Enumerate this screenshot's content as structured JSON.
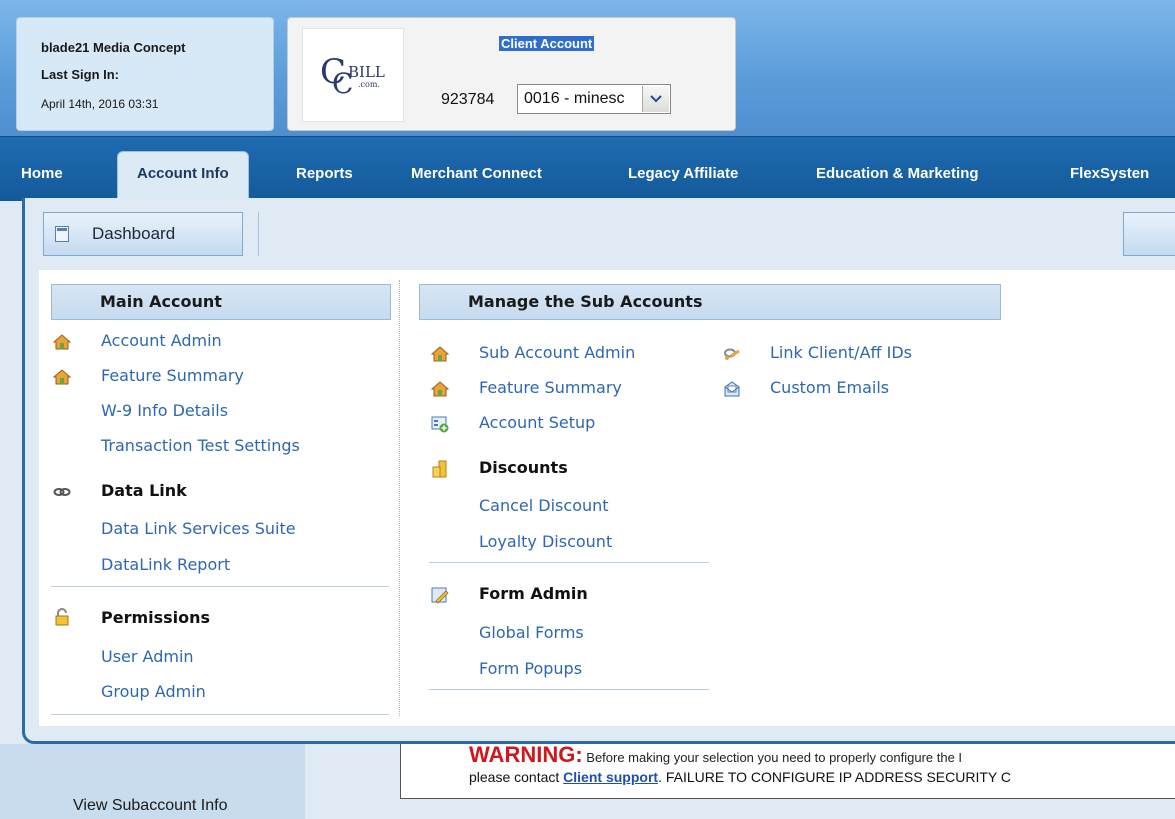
{
  "user": {
    "name_line": "blade21  Media Concept",
    "last_sign_in_label": "Last Sign In:",
    "last_sign_in_date": "April 14th, 2016 03:31"
  },
  "client": {
    "title": "Client Account",
    "logo_text": "CCBILL .com.",
    "id": "923784",
    "selected_subaccount": "0016 - minesc"
  },
  "nav": {
    "items": [
      {
        "label": "Home"
      },
      {
        "label": "Account Info"
      },
      {
        "label": "Reports"
      },
      {
        "label": "Merchant Connect"
      },
      {
        "label": "Legacy Affiliate"
      },
      {
        "label": "Education & Marketing"
      },
      {
        "label": "FlexSysten"
      }
    ],
    "active": "Account Info"
  },
  "panel": {
    "dashboard_label": "Dashboard",
    "main_account": {
      "title": "Main Account",
      "links": [
        "Account Admin",
        "Feature Summary",
        "W-9 Info Details",
        "Transaction Test Settings"
      ],
      "data_link": {
        "heading": "Data Link",
        "links": [
          "Data Link Services Suite",
          "DataLink Report"
        ]
      },
      "permissions": {
        "heading": "Permissions",
        "links": [
          "User Admin",
          "Group Admin"
        ]
      }
    },
    "sub_accounts": {
      "title": "Manage the Sub Accounts",
      "links_col1": [
        "Sub Account Admin",
        "Feature Summary",
        "Account Setup"
      ],
      "links_col2": [
        "Link Client/Aff IDs",
        "Custom Emails"
      ],
      "discounts": {
        "heading": "Discounts",
        "links": [
          "Cancel Discount",
          "Loyalty Discount"
        ]
      },
      "form_admin": {
        "heading": "Form Admin",
        "links": [
          "Global Forms",
          "Form Popups"
        ]
      }
    }
  },
  "sidebar": {
    "view_subaccount": "View Subaccount Info"
  },
  "warning": {
    "label": "WARNING:",
    "line1": " Before making your selection you need to properly configure the I",
    "line2_prefix": "please contact ",
    "line2_link": "Client support",
    "line2_suffix": ". FAILURE TO CONFIGURE IP ADDRESS SECURITY C"
  },
  "colors": {
    "nav_bg": "#1f6bb0",
    "link": "#2e67b1",
    "warning_red": "#d2161b"
  }
}
